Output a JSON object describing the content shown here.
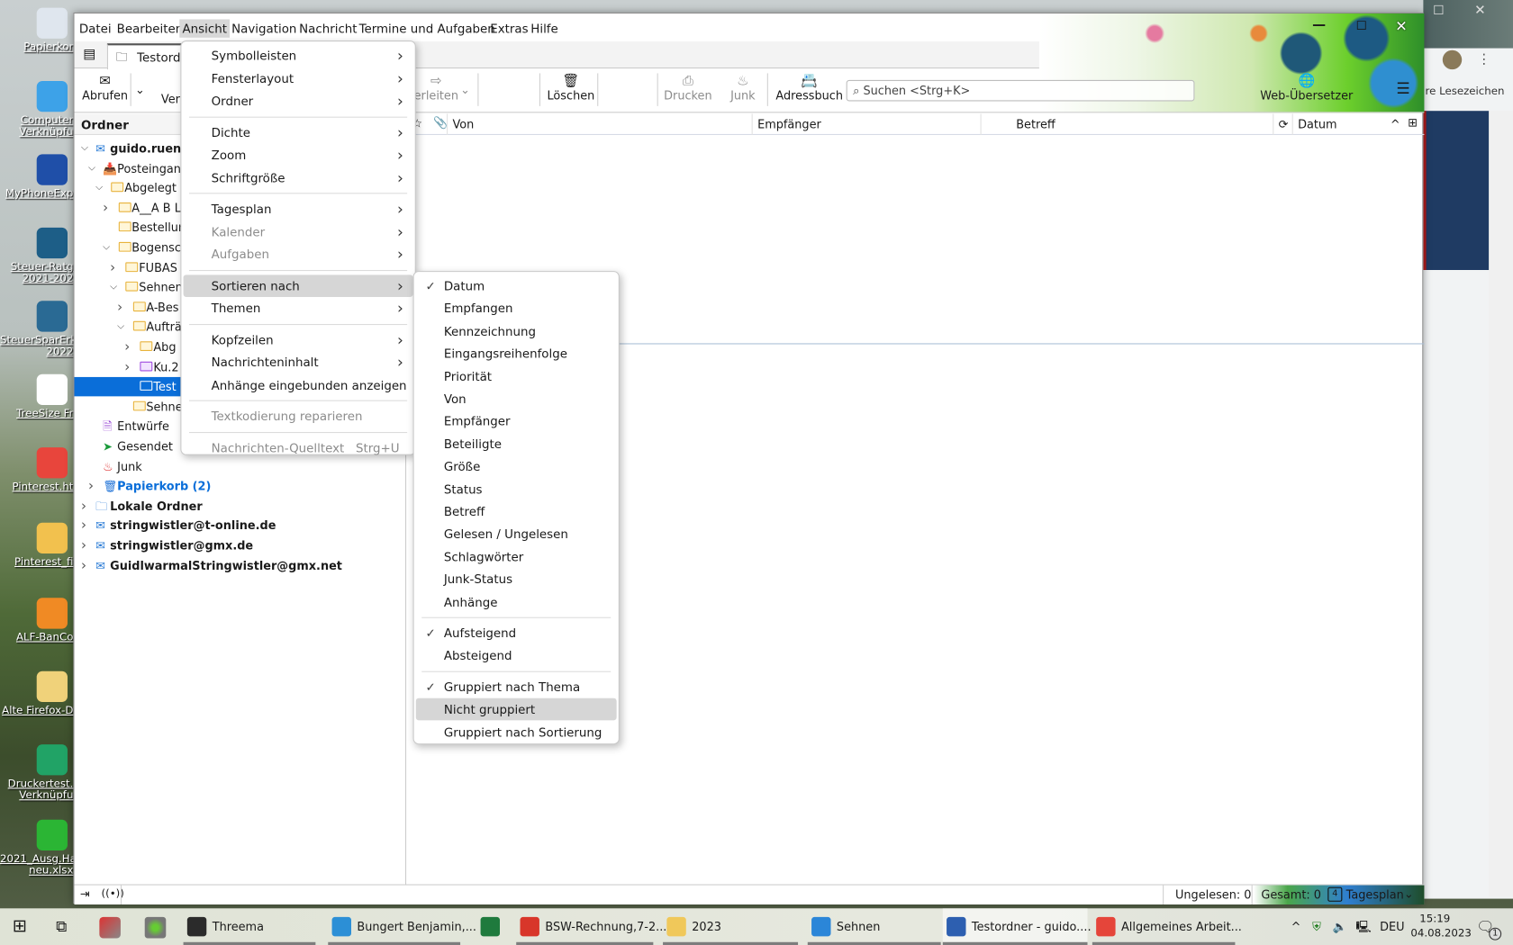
{
  "desktop": {
    "icons": [
      {
        "label": "Papierkor",
        "color": "#dfe6ee"
      },
      {
        "label": "Computer\nVerknüpfu",
        "color": "#3da2e8"
      },
      {
        "label": "MyPhoneExp",
        "color": "#1f4fa8"
      },
      {
        "label": "Steuer-Ratg\n2021-202",
        "color": "#1d5e87"
      },
      {
        "label": "SteuerSparErkl\n2022",
        "color": "#2a6a94"
      },
      {
        "label": "TreeSize Fr",
        "color": "#ffffff"
      },
      {
        "label": "Pinterest.ht",
        "color": "#e8453c"
      },
      {
        "label": "Pinterest_fi",
        "color": "#f2c14e"
      },
      {
        "label": "ALF-BanCo",
        "color": "#f08a24"
      },
      {
        "label": "Alte Firefox-D",
        "color": "#f0d27a"
      },
      {
        "label": "Druckertest.\nVerknüpfu",
        "color": "#21a366"
      },
      {
        "label": "2021_Ausg.Har\nneu.xlsx",
        "color": "#2bb534"
      }
    ]
  },
  "background_window": {
    "bookmarks_label": "re Lesezeichen"
  },
  "menubar": [
    "Datei",
    "Bearbeiten",
    "Ansicht",
    "Navigation",
    "Nachricht",
    "Termine und Aufgaben",
    "Extras",
    "Hilfe"
  ],
  "tab": {
    "label": "Testordner"
  },
  "toolbar": {
    "abrufen": "Abrufen",
    "verfassen": "Ver",
    "weiterleiten": "erleiten",
    "loeschen": "Löschen",
    "drucken": "Drucken",
    "junk": "Junk",
    "adressbuch": "Adressbuch",
    "search_placeholder": "Suchen <Strg+K>",
    "web_uebersetzer": "Web-Übersetzer"
  },
  "folder_pane": {
    "header": "Ordner",
    "folders": [
      {
        "label": "guido.ruena",
        "level": 0,
        "twisty": "open",
        "bold": true,
        "icon": "account"
      },
      {
        "label": "Posteingan",
        "level": 1,
        "twisty": "open",
        "icon": "inbox"
      },
      {
        "label": "Abgelegt",
        "level": 2,
        "twisty": "open",
        "icon": "folder"
      },
      {
        "label": "A__A B L",
        "level": 3,
        "twisty": "closed",
        "icon": "folder"
      },
      {
        "label": "Bestellun",
        "level": 3,
        "twisty": "none",
        "icon": "folder"
      },
      {
        "label": "Bogensc",
        "level": 3,
        "twisty": "open",
        "icon": "folder"
      },
      {
        "label": "FUBAS",
        "level": 4,
        "twisty": "closed",
        "icon": "folder"
      },
      {
        "label": "Sehnen",
        "level": 4,
        "twisty": "open",
        "icon": "folder"
      },
      {
        "label": "A-Bes",
        "level": 5,
        "twisty": "closed",
        "icon": "folder"
      },
      {
        "label": "Aufträ",
        "level": 5,
        "twisty": "open",
        "icon": "folder"
      },
      {
        "label": "Abg",
        "level": 6,
        "twisty": "closed",
        "icon": "folder"
      },
      {
        "label": "Ku.2",
        "level": 6,
        "twisty": "closed",
        "icon": "folder-purple"
      },
      {
        "label": "Test",
        "level": 6,
        "twisty": "none",
        "icon": "folder",
        "selected": true
      },
      {
        "label": "Sehne",
        "level": 5,
        "twisty": "none",
        "icon": "folder"
      },
      {
        "label": "Entwürfe",
        "level": 1,
        "twisty": "none",
        "icon": "drafts"
      },
      {
        "label": "Gesendet",
        "level": 1,
        "twisty": "none",
        "icon": "sent"
      },
      {
        "label": "Junk",
        "level": 1,
        "twisty": "none",
        "icon": "junk"
      },
      {
        "label": "Papierkorb (2)",
        "level": 1,
        "twisty": "closed",
        "icon": "trash",
        "bold": true,
        "unread": true
      },
      {
        "label": "Lokale Ordner",
        "level": 0,
        "twisty": "closed",
        "bold": true,
        "icon": "local"
      },
      {
        "label": "stringwistler@t-online.de",
        "level": 0,
        "twisty": "closed",
        "bold": true,
        "icon": "account"
      },
      {
        "label": "stringwistler@gmx.de",
        "level": 0,
        "twisty": "closed",
        "bold": true,
        "icon": "account"
      },
      {
        "label": "GuidlwarmalStringwistler@gmx.net",
        "level": 0,
        "twisty": "closed",
        "bold": true,
        "icon": "account"
      }
    ]
  },
  "thread_columns": {
    "von": "Von",
    "empfaenger": "Empfänger",
    "betreff": "Betreff",
    "datum": "Datum"
  },
  "ansicht_menu": [
    {
      "label": "Symbolleisten",
      "sub": true
    },
    {
      "label": "Fensterlayout",
      "sub": true
    },
    {
      "label": "Ordner",
      "sub": true
    },
    {
      "sep": true
    },
    {
      "label": "Dichte",
      "sub": true
    },
    {
      "label": "Zoom",
      "sub": true
    },
    {
      "label": "Schriftgröße",
      "sub": true
    },
    {
      "sep": true
    },
    {
      "label": "Tagesplan",
      "sub": true
    },
    {
      "label": "Kalender",
      "sub": true,
      "disabled": true
    },
    {
      "label": "Aufgaben",
      "sub": true,
      "disabled": true
    },
    {
      "sep": true
    },
    {
      "label": "Sortieren nach",
      "sub": true,
      "hover": true
    },
    {
      "label": "Themen",
      "sub": true
    },
    {
      "sep": true
    },
    {
      "label": "Kopfzeilen",
      "sub": true
    },
    {
      "label": "Nachrichteninhalt",
      "sub": true
    },
    {
      "label": "Anhänge eingebunden anzeigen"
    },
    {
      "sep": true
    },
    {
      "label": "Textkodierung reparieren",
      "disabled": true
    },
    {
      "sep": true
    },
    {
      "label": "Nachrichten-Quelltext",
      "shortcut": "Strg+U",
      "disabled": true
    }
  ],
  "sort_menu": [
    {
      "label": "Datum",
      "checked": true
    },
    {
      "label": "Empfangen"
    },
    {
      "label": "Kennzeichnung"
    },
    {
      "label": "Eingangsreihenfolge"
    },
    {
      "label": "Priorität"
    },
    {
      "label": "Von"
    },
    {
      "label": "Empfänger"
    },
    {
      "label": "Beteiligte"
    },
    {
      "label": "Größe"
    },
    {
      "label": "Status"
    },
    {
      "label": "Betreff"
    },
    {
      "label": "Gelesen / Ungelesen"
    },
    {
      "label": "Schlagwörter"
    },
    {
      "label": "Junk-Status"
    },
    {
      "label": "Anhänge"
    },
    {
      "sep": true
    },
    {
      "label": "Aufsteigend",
      "checked": true
    },
    {
      "label": "Absteigend"
    },
    {
      "sep": true
    },
    {
      "label": "Gruppiert nach Thema",
      "checked": true
    },
    {
      "label": "Nicht gruppiert",
      "hover": true
    },
    {
      "label": "Gruppiert nach Sortierung"
    }
  ],
  "statusbar": {
    "ungelesen": "Ungelesen: 0",
    "gesamt": "Gesamt: 0",
    "tagesplan": "Tagesplan",
    "calendar_day": "4"
  },
  "taskbar": {
    "apps": [
      {
        "label": "Threema",
        "color": "#2b2b2b"
      },
      {
        "label": "Bungert Benjamin,...",
        "color": "#2c8fd6"
      },
      {
        "label": "",
        "color": "#1f7a3d"
      },
      {
        "label": "BSW-Rechnung,7-2...",
        "color": "#d8362a"
      },
      {
        "label": "2023",
        "color": "#f0c85a"
      },
      {
        "label": "Sehnen",
        "color": "#2b86d8"
      },
      {
        "label": "Testordner - guido....",
        "color": "#2d5fb0",
        "active": true
      },
      {
        "label": "Allgemeines Arbeit...",
        "color": "#e5453a"
      }
    ],
    "language": "DEU",
    "time": "15:19",
    "date": "04.08.2023",
    "notifications": "1"
  },
  "colors": {
    "selection": "#0a6ed9",
    "unread_folder": "#0a6ed9"
  }
}
